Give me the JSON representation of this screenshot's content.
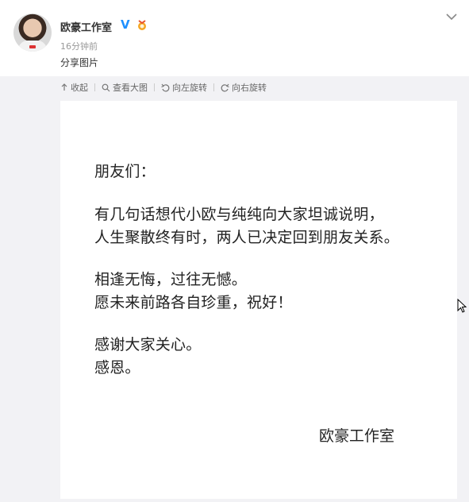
{
  "post": {
    "author": "欧豪工作室",
    "verified_badge": "V",
    "time": "16分钟前",
    "text": "分享图片"
  },
  "toolbar": {
    "collapse": "收起",
    "view_large": "查看大图",
    "rotate_left": "向左旋转",
    "rotate_right": "向右旋转"
  },
  "letter": {
    "greeting": "朋友们：",
    "line1": "有几句话想代小欧与纯纯向大家坦诚说明，",
    "line2": "人生聚散终有时，两人已决定回到朋友关系。",
    "line3": "相逢无悔，过往无憾。",
    "line4": "愿未来前路各自珍重，祝好！",
    "line5": "感谢大家关心。",
    "line6": "感恩。",
    "signature": "欧豪工作室"
  },
  "colors": {
    "accent": "#1e90ff",
    "panel_bg": "#f2f2f5"
  },
  "icons": [
    "avatar",
    "verified-icon",
    "medal-icon",
    "chevron-down-icon",
    "collapse-arrow-icon",
    "search-icon",
    "rotate-left-icon",
    "rotate-right-icon",
    "cursor-icon"
  ]
}
